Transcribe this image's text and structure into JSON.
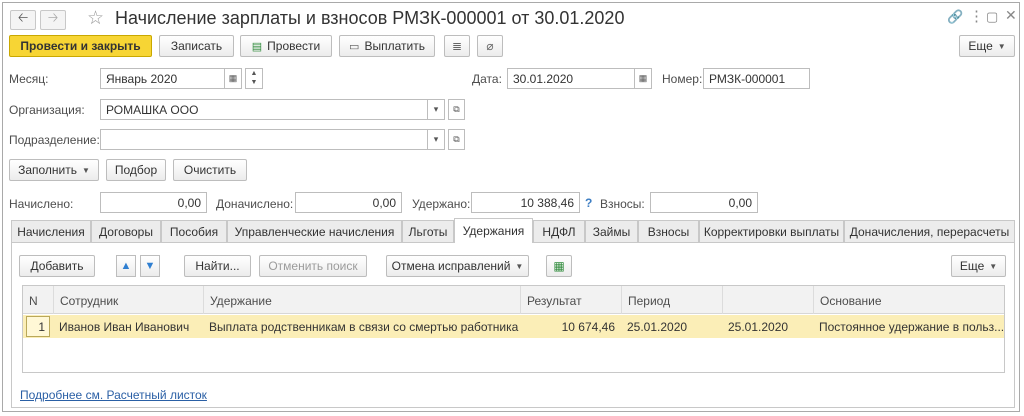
{
  "window": {
    "title": "Начисление зарплаты и взносов РМЗК-000001 от 30.01.2020",
    "nav_back_icon": "arrow-left-icon",
    "nav_forward_icon": "arrow-right-icon",
    "favorite_icon": "star-icon",
    "link_icon": "link-icon",
    "menu_icon": "more-vertical-icon",
    "restore_icon": "restore-icon",
    "close_icon": "close-icon"
  },
  "toolbar": {
    "post_close": "Провести и закрыть",
    "save": "Записать",
    "post": "Провести",
    "pay": "Выплатить",
    "more": "Еще"
  },
  "header": {
    "month_label": "Месяц:",
    "month_value": "Январь 2020",
    "date_label": "Дата:",
    "date_value": "30.01.2020",
    "number_label": "Номер:",
    "number_value": "РМЗК-000001",
    "org_label": "Организация:",
    "org_value": "РОМАШКА ООО",
    "dept_label": "Подразделение:",
    "dept_value": ""
  },
  "actions": {
    "fill": "Заполнить",
    "select": "Подбор",
    "clear": "Очистить"
  },
  "totals": {
    "accrued_label": "Начислено:",
    "accrued_value": "0,00",
    "additional_label": "Доначислено:",
    "additional_value": "0,00",
    "withheld_label": "Удержано:",
    "withheld_value": "10 388,46",
    "help_mark": "?",
    "contrib_label": "Взносы:",
    "contrib_value": "0,00"
  },
  "tabs": [
    {
      "label": "Начисления"
    },
    {
      "label": "Договоры"
    },
    {
      "label": "Пособия"
    },
    {
      "label": "Управленческие начисления"
    },
    {
      "label": "Льготы"
    },
    {
      "label": "Удержания"
    },
    {
      "label": "НДФЛ"
    },
    {
      "label": "Займы"
    },
    {
      "label": "Взносы"
    },
    {
      "label": "Корректировки выплаты"
    },
    {
      "label": "Доначисления, перерасчеты"
    }
  ],
  "active_tab": "Удержания",
  "panel": {
    "add": "Добавить",
    "find": "Найти...",
    "cancel_search": "Отменить поиск",
    "cancel_fix": "Отмена исправлений",
    "more": "Еще",
    "footer_link": "Подробнее см. Расчетный листок"
  },
  "table": {
    "columns": [
      "N",
      "Сотрудник",
      "Удержание",
      "Результат",
      "Период",
      "",
      "Основание"
    ],
    "rows": [
      {
        "n": "1",
        "employee": "Иванов Иван Иванович",
        "deduction": "Выплата родственникам в связи со смертью работника",
        "result": "10 674,46",
        "period": "25.01.2020",
        "period2": "25.01.2020",
        "basis": "Постоянное удержание в польз..."
      }
    ]
  },
  "colors": {
    "primary_button": "#f7d534",
    "selected_row": "#fbeeb7",
    "link": "#2a5fa5"
  }
}
